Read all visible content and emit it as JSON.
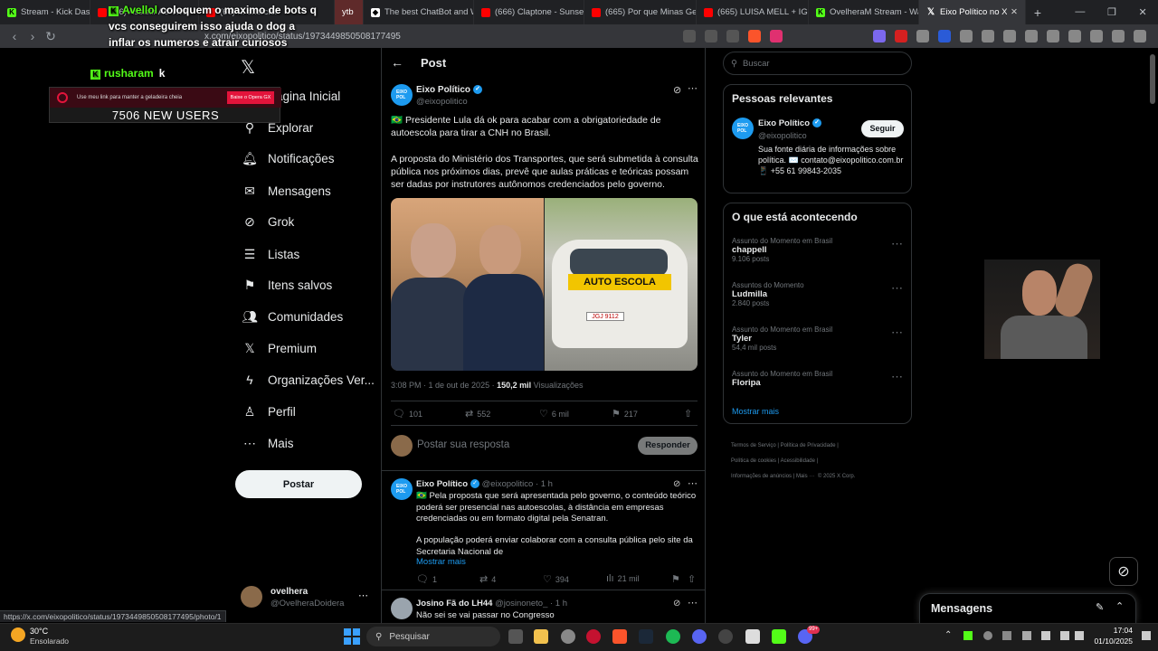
{
  "browser": {
    "tabs": [
      {
        "label": "Stream - Kick Dashboard",
        "color": "#53fc18"
      },
      {
        "label": "(66) Assistir Ao Vivo",
        "color": "#ff0000"
      },
      {
        "label": "(66) ... exercíci",
        "color": "#ff0000"
      },
      {
        "label": "ytb",
        "color": "#777"
      },
      {
        "label": "The best ChatBot and W",
        "color": "#ffffff"
      },
      {
        "label": "(666) Claptone - Sunset N",
        "color": "#ff0000"
      },
      {
        "label": "(665) Por que Minas Gera",
        "color": "#ff0000"
      },
      {
        "label": "(665) LUISA MELL + IGOR",
        "color": "#ff0000"
      },
      {
        "label": "OvelheraM Stream - Wat",
        "color": "#53fc18"
      },
      {
        "label": "Eixo Político no X: \"a",
        "color": "#ffffff"
      }
    ],
    "url": "x.com/eixopolitico/status/1973449850508177495",
    "status_url": "https://x.com/eixopolitico/status/1973449850508177495/photo/1"
  },
  "stream_overlay": {
    "chat_user1": "Avellol",
    "chat_msg1": "coloquem o maximo de bots q vcs conseguirem isso ajuda o dog a inflar os numeros e atrair curiosos",
    "chat_user2": "rusharam",
    "chat_msg2": "k",
    "banner_text": "Use meu link para manter a geladeira cheia",
    "banner_button": "Baixe o Opera GX",
    "new_users": "7506 NEW USERS"
  },
  "sidebar": {
    "items": [
      {
        "label": "Página Inicial",
        "icon": "home-icon"
      },
      {
        "label": "Explorar",
        "icon": "search-icon"
      },
      {
        "label": "Notificações",
        "icon": "bell-icon"
      },
      {
        "label": "Mensagens",
        "icon": "mail-icon"
      },
      {
        "label": "Grok",
        "icon": "grok-icon"
      },
      {
        "label": "Listas",
        "icon": "list-icon"
      },
      {
        "label": "Itens salvos",
        "icon": "bookmark-icon"
      },
      {
        "label": "Comunidades",
        "icon": "people-icon"
      },
      {
        "label": "Premium",
        "icon": "x-icon"
      },
      {
        "label": "Organizações Ver...",
        "icon": "bolt-icon"
      },
      {
        "label": "Perfil",
        "icon": "person-icon"
      },
      {
        "label": "Mais",
        "icon": "more-icon"
      }
    ],
    "post_button": "Postar",
    "account_name": "ovelhera",
    "account_handle": "@OvelheraDoidera"
  },
  "post": {
    "header": "Post",
    "author": "Eixo Político",
    "handle": "@eixopolitico",
    "text1": "🇧🇷 Presidente Lula dá ok para acabar com a obrigatoriedade de autoescola para tirar a CNH no Brasil.",
    "text2": "A proposta do Ministério dos Transportes, que será submetida à consulta pública nos próximos dias, prevê que aulas práticas e teóricas possam ser dadas por instrutores autônomos credenciados pelo governo.",
    "car_sign": "AUTO ESCOLA",
    "plate": "JGJ 9112",
    "time": "3:08 PM · 1 de out de 2025 · ",
    "views": "150,2 mil",
    "views_label": "Visualizações",
    "replies": "101",
    "reposts": "552",
    "likes": "6 mil",
    "bookmarks": "217",
    "reply_placeholder": "Postar sua resposta",
    "reply_button": "Responder"
  },
  "reply1": {
    "author": "Eixo Político",
    "handle": "@eixopolitico · 1 h",
    "text1": "🇧🇷 Pela proposta que será apresentada pelo governo, o conteúdo teórico poderá ser presencial nas autoescolas, à distância em empresas credenciadas ou em formato digital pela Senatran.",
    "text2": "A população poderá enviar colaborar com a consulta pública pelo site da Secretaria Nacional de",
    "show_more": "Mostrar mais",
    "replies": "1",
    "reposts": "4",
    "likes": "394",
    "views": "21 mil"
  },
  "reply2": {
    "author": "Josino Fã do LH44",
    "handle": "@josinoneto_ · 1 h",
    "text": "Não sei se vai passar no Congresso"
  },
  "right": {
    "search_placeholder": "Buscar",
    "relevant_title": "Pessoas relevantes",
    "relevant_name": "Eixo Político",
    "relevant_handle": "@eixopolitico",
    "follow_button": "Seguir",
    "bio": "Sua fonte diária de informações sobre política. ✉️ contato@eixopolitico.com.br 📱 +55 61 99843-2035",
    "trends_title": "O que está acontecendo",
    "trends": [
      {
        "context": "Assunto do Momento em Brasil",
        "name": "chappell",
        "count": "9.106 posts"
      },
      {
        "context": "Assuntos do Momento",
        "name": "Ludmilla",
        "count": "2.840 posts"
      },
      {
        "context": "Assunto do Momento em Brasil",
        "name": "Tyler",
        "count": "54,4 mil posts"
      },
      {
        "context": "Assunto do Momento em Brasil",
        "name": "Floripa",
        "count": ""
      }
    ],
    "show_more": "Mostrar mais",
    "footer": [
      "Termos de Serviço",
      "Política de Privacidade",
      "Política de cookies",
      "Acessibilidade",
      "Informações de anúncios",
      "Mais ···",
      "© 2025 X Corp."
    ],
    "messages": "Mensagens"
  },
  "taskbar": {
    "temp": "30°C",
    "weather": "Ensolarado",
    "search": "Pesquisar",
    "time": "17:04",
    "date": "01/10/2025",
    "badge": "99+"
  }
}
